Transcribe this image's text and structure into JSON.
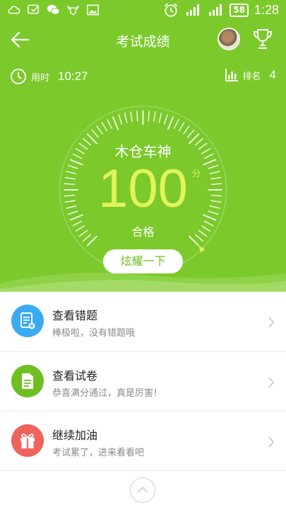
{
  "status_bar": {
    "icons": [
      "cloud-icon",
      "message-icon",
      "wechat-icon",
      "bull-icon",
      "image-icon",
      "alarm-icon",
      "signal-icon",
      "signal-icon-2"
    ],
    "battery": "58",
    "time": "1:28"
  },
  "header": {
    "title": "考试成绩",
    "back_icon": "back-arrow-icon",
    "trophy_icon": "trophy-icon"
  },
  "stats": {
    "time_label": "用时",
    "time_value": "10:27",
    "rank_label": "排名",
    "rank_value": "4"
  },
  "result": {
    "player_name": "木仓车神",
    "score": "100",
    "score_unit": "分",
    "verdict": "合格",
    "gauge_fraction": 1.0,
    "show_off_button": "炫耀一下"
  },
  "list": [
    {
      "title": "查看错题",
      "subtitle": "棒极啦，没有错题哦",
      "icon": "wrong-questions-icon",
      "color": "#3aaaf2"
    },
    {
      "title": "查看试卷",
      "subtitle": "恭喜满分通过，真是厉害！",
      "icon": "exam-paper-icon",
      "color": "#6fbf22"
    },
    {
      "title": "继续加油",
      "subtitle": "考试累了，进来看看吧",
      "icon": "gift-icon",
      "color": "#f0625c"
    }
  ],
  "colors": {
    "primary_green": "#7cc92c",
    "score_yellow": "#e1f45a"
  }
}
